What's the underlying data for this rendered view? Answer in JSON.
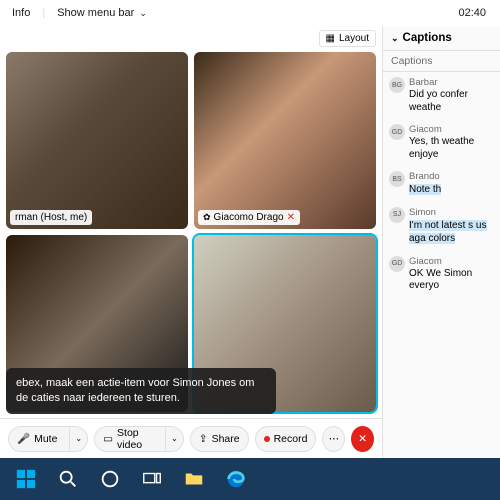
{
  "topbar": {
    "info": "Info",
    "menubar": "Show menu bar",
    "clock": "02:40"
  },
  "layout_label": "Layout",
  "tiles": [
    {
      "name": "rman (Host, me)",
      "host": true,
      "muted": false,
      "speaking": false
    },
    {
      "name": "Giacomo Drago",
      "host": false,
      "muted": true,
      "speaking": false
    },
    {
      "name": "",
      "host": false,
      "muted": false,
      "speaking": false
    },
    {
      "name": "",
      "host": false,
      "muted": false,
      "speaking": true
    }
  ],
  "live_caption": "ebex, maak een actie-item voor Simon Jones om de caties naar iedereen te sturen.",
  "controls": {
    "mute": "Mute",
    "video": "Stop video",
    "share": "Share",
    "record": "Record"
  },
  "side": {
    "title": "Captions",
    "tab": "Captions",
    "items": [
      {
        "initials": "BG",
        "name": "Barbar",
        "text": "Did yo confer weathe",
        "hl": false
      },
      {
        "initials": "GD",
        "name": "Giacom",
        "text": "Yes, th weathe enjoye",
        "hl": false
      },
      {
        "initials": "BS",
        "name": "Brando",
        "text": "Note th",
        "hl": true
      },
      {
        "initials": "SJ",
        "name": "Simon",
        "text": "I'm not latest s us aga colors",
        "hl": true
      },
      {
        "initials": "GD",
        "name": "Giacom",
        "text": "OK We Simon everyo",
        "hl": false
      }
    ]
  },
  "taskbar_icons": [
    "start",
    "search",
    "cortana",
    "task-view",
    "file-explorer",
    "edge"
  ]
}
